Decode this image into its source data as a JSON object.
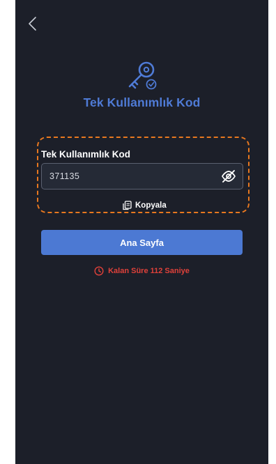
{
  "header": {
    "back_icon": "chevron-left-icon"
  },
  "hero": {
    "icon": "key-with-badge-icon",
    "title": "Tek Kullanımlık Kod"
  },
  "otp": {
    "label": "Tek Kullanımlık Kod",
    "value": "371135",
    "visibility_icon": "eye-off-icon",
    "copy_icon": "copy-icon",
    "copy_label": "Kopyala"
  },
  "actions": {
    "home_label": "Ana Sayfa"
  },
  "timer": {
    "icon": "clock-icon",
    "label": "Kalan Süre 112 Saniye"
  },
  "colors": {
    "background": "#1c1f29",
    "accent": "#4c79d3",
    "title": "#4f7bd6",
    "warning": "#e0413a",
    "highlight": "#e8781f"
  }
}
